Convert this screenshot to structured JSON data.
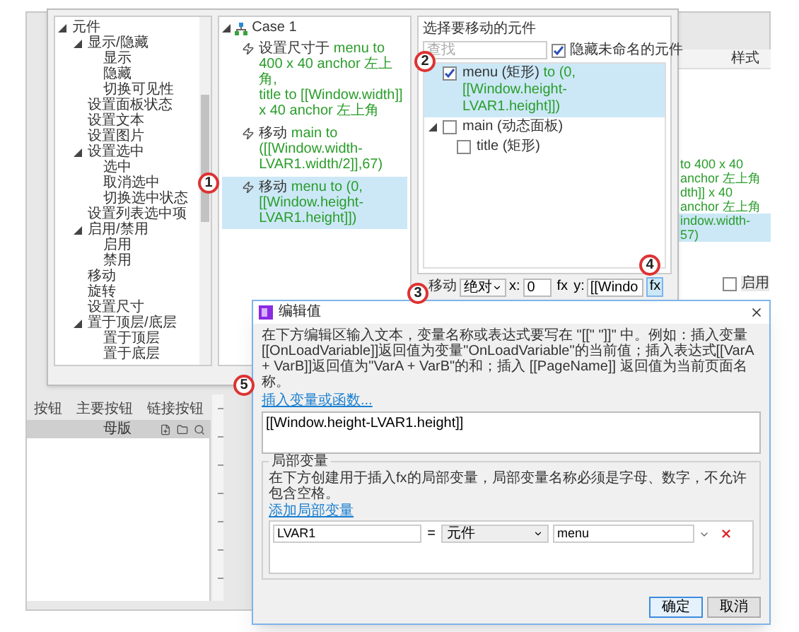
{
  "background_app": {
    "widgets": [
      "按钮",
      "主要按钮",
      "链接按钮"
    ],
    "masters_title": "母版",
    "table_header": "样式",
    "action_lines": [
      {
        "lines": [
          "to 400 x 40 anchor 左上角",
          "dth]] x 40 anchor 左上角"
        ],
        "selected": false
      },
      {
        "lines": [
          "indow.width-",
          "57)"
        ],
        "selected": true
      }
    ],
    "enable": {
      "label": "启用",
      "checked": false
    }
  },
  "case_dialog": {
    "tree": [
      {
        "label": "元件",
        "expanded": true,
        "children": [
          {
            "label": "显示/隐藏",
            "expanded": true,
            "children": [
              {
                "label": "显示"
              },
              {
                "label": "隐藏"
              },
              {
                "label": "切换可见性"
              }
            ]
          },
          {
            "label": "设置面板状态"
          },
          {
            "label": "设置文本"
          },
          {
            "label": "设置图片"
          },
          {
            "label": "设置选中",
            "expanded": true,
            "children": [
              {
                "label": "选中"
              },
              {
                "label": "取消选中"
              },
              {
                "label": "切换选中状态"
              }
            ]
          },
          {
            "label": "设置列表选中项"
          },
          {
            "label": "启用/禁用",
            "expanded": true,
            "children": [
              {
                "label": "启用"
              },
              {
                "label": "禁用"
              }
            ]
          },
          {
            "label": "移动"
          },
          {
            "label": "旋转"
          },
          {
            "label": "设置尺寸"
          },
          {
            "label": "置于顶层/底层",
            "expanded": true,
            "children": [
              {
                "label": "置于顶层"
              },
              {
                "label": "置于底层"
              }
            ]
          }
        ]
      }
    ],
    "case": {
      "label": "Case 1",
      "expanded": true,
      "actions": [
        {
          "verb": "设置尺寸于",
          "detail": [
            "menu to 400 x 40 anchor 左上角,",
            "title to [[Window.width]] x 40 anchor 左上角"
          ],
          "selected": false
        },
        {
          "verb": "移动",
          "detail": [
            "main to ([[Window.width-LVAR1.width/2]],67)"
          ],
          "selected": false
        },
        {
          "verb": "移动",
          "detail": [
            "menu to (0,[[Window.height-LVAR1.height]])"
          ],
          "selected": true
        }
      ]
    },
    "picker": {
      "title": "选择要移动的元件",
      "placeholder": "查找",
      "hide_unnamed": {
        "label": "隐藏未命名的元件",
        "checked": true
      },
      "elements": [
        {
          "name": "menu (矩形)",
          "detail": "to (0,[[Window.height-LVAR1.height]])",
          "checked": true,
          "selected": true
        },
        {
          "name": "main (动态面板)",
          "checked": false,
          "selected": false,
          "expanded": true,
          "children": [
            {
              "name": "title (矩形)",
              "checked": false,
              "selected": false
            }
          ]
        }
      ]
    },
    "move_row": {
      "label": "移动",
      "mode": "绝对",
      "x_label": "x:",
      "x_value": "0",
      "x_fx": {
        "label": "fx",
        "selected": false
      },
      "y_label": "y:",
      "y_value": "[[Windo",
      "y_fx": {
        "label": "fx",
        "selected": true
      }
    }
  },
  "expression_dialog": {
    "title": "编辑值",
    "description": "在下方编辑区输入文本，变量名称或表达式要写在 \"[[\" \"]]\" 中。例如：插入变量[[OnLoadVariable]]返回值为变量\"OnLoadVariable\"的当前值；插入表达式[[VarA + VarB]]返回值为\"VarA + VarB\"的和；插入 [[PageName]] 返回值为当前页面名称。",
    "insert_link": "插入变量或函数...",
    "value": "[[Window.height-LVAR1.height]]",
    "locals": {
      "title": "局部变量",
      "description": "在下方创建用于插入fx的局部变量，局部变量名称必须是字母、数字，不允许包含空格。",
      "add_link": "添加局部变量",
      "rows": [
        {
          "name": "LVAR1",
          "equals": "=",
          "type": "元件",
          "target": "menu"
        }
      ]
    },
    "buttons": [
      {
        "label": "确定",
        "kind": "primary"
      },
      {
        "label": "取消",
        "kind": "secondary"
      }
    ]
  },
  "callouts": [
    "1",
    "2",
    "3",
    "4",
    "5"
  ]
}
